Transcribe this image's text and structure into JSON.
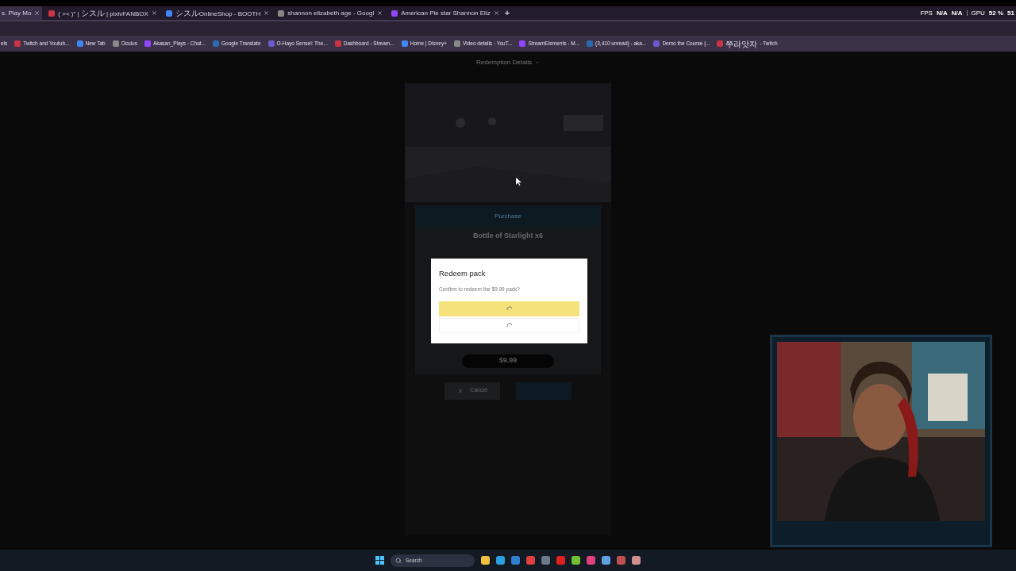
{
  "tabs": [
    {
      "title": "s. Play Mo",
      "selected": true
    },
    {
      "title": "( >< )\" | シスル | pixivFANBOX",
      "selected": false
    },
    {
      "title": "シスルOnlineShop - BOOTH",
      "selected": false
    },
    {
      "title": "shannon elizabeth age - Googl",
      "selected": false
    },
    {
      "title": "American Pie star Shannon Eliz",
      "selected": false
    }
  ],
  "new_tab": "+",
  "overlay_stats": {
    "fps_label": "FPS",
    "fps_values": [
      "N/A",
      "N/A"
    ],
    "gpu_label": "GPU",
    "gpu_value": "52 %",
    "gpu_extra": "51"
  },
  "bookmarks": [
    "els",
    "Twitch and Youtub...",
    "New Tab",
    "Oculus",
    "Akasan_Plays - Chat...",
    "Google Translate",
    "O-Hayo Sensei: The...",
    "Dashboard - Stream...",
    "Home | Disney+",
    "Video details - YouT...",
    "StreamElements - M...",
    "(3,410 unread) - aka...",
    "Demo the Course |...",
    "쭈라앗자 - Twitch"
  ],
  "page": {
    "header": "Redemption Details",
    "purchase": {
      "title": "Purchase",
      "item": "Bottle of Starlight x6",
      "price": "$9.99",
      "cancel": "Cancel"
    },
    "dialog": {
      "title": "Redeem pack",
      "message": "Confirm to redeem the $9.99 pack?",
      "confirm_loading": true,
      "cancel_loading": true
    }
  },
  "taskbar": {
    "search_placeholder": "Search"
  }
}
